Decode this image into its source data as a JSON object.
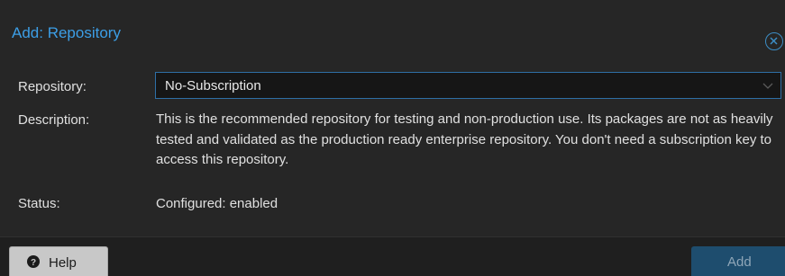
{
  "dialog": {
    "title": "Add: Repository",
    "accent_color": "#3c9ee6"
  },
  "form": {
    "repository_label": "Repository:",
    "repository_value": "No-Subscription",
    "description_label": "Description:",
    "description_text": "This is the recommended repository for testing and non-production use. Its packages are not as heavily tested and validated as the production ready enterprise repository. You don't need a subscription key to access this repository.",
    "status_label": "Status:",
    "status_value": "Configured: enabled"
  },
  "footer": {
    "help_label": "Help",
    "add_label": "Add"
  },
  "icons": {
    "close": "close-circle-icon",
    "dropdown": "chevron-down-icon",
    "help": "question-circle-icon"
  }
}
